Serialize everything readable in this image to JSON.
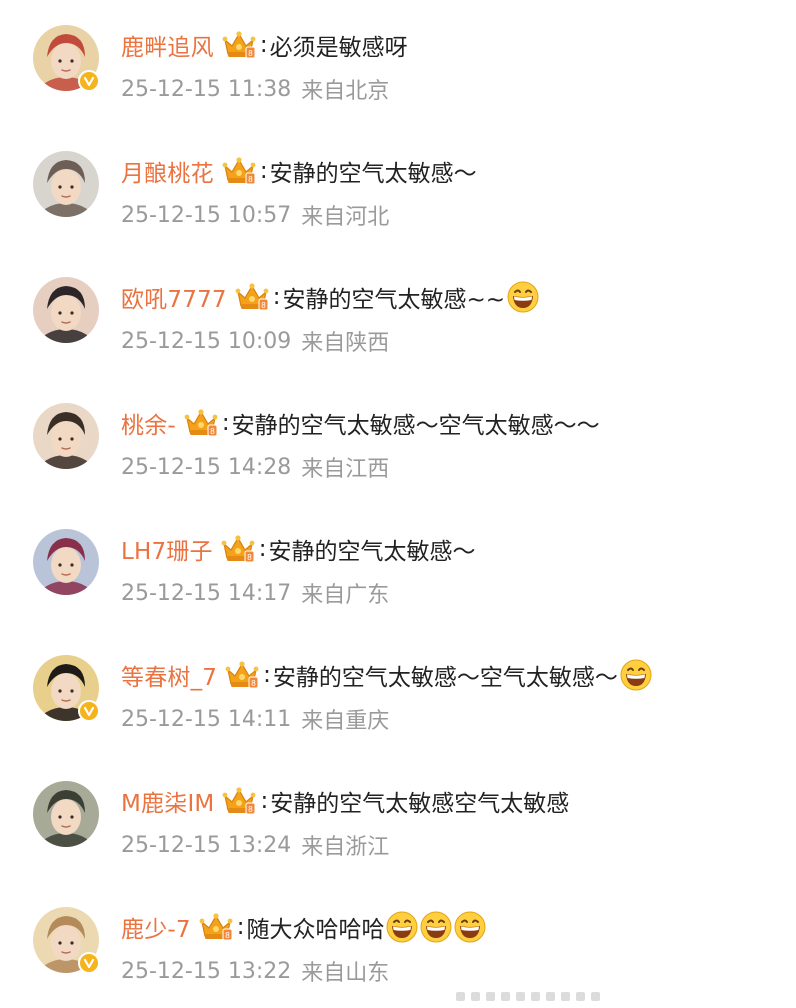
{
  "comments": [
    {
      "username": "鹿畔追风",
      "text": "必须是敏感呀",
      "time": "25-12-15 11:38",
      "location": "来自北京",
      "verified": true,
      "emoji_count": 0,
      "avatar_colors": [
        "#e9d2a6",
        "#c24a3c"
      ]
    },
    {
      "username": "月酿桃花",
      "text": "安静的空气太敏感～",
      "time": "25-12-15 10:57",
      "location": "来自河北",
      "verified": false,
      "emoji_count": 0,
      "avatar_colors": [
        "#d8d5cf",
        "#6d5f55"
      ]
    },
    {
      "username": "欧吼7777",
      "text": "安静的空气太敏感~~",
      "time": "25-12-15 10:09",
      "location": "来自陕西",
      "verified": false,
      "emoji_count": 1,
      "avatar_colors": [
        "#e6cfc0",
        "#2c2628"
      ]
    },
    {
      "username": "桃余-",
      "text": "安静的空气太敏感～空气太敏感～～",
      "time": "25-12-15 14:28",
      "location": "来自江西",
      "verified": false,
      "emoji_count": 0,
      "avatar_colors": [
        "#ead8c6",
        "#3a2e27"
      ]
    },
    {
      "username": "LH7珊子",
      "text": "安静的空气太敏感～",
      "time": "25-12-15 14:17",
      "location": "来自广东",
      "verified": false,
      "emoji_count": 0,
      "avatar_colors": [
        "#b9c4d9",
        "#8a2f4a"
      ]
    },
    {
      "username": "等春树_7",
      "text": "安静的空气太敏感～空气太敏感～",
      "time": "25-12-15 14:11",
      "location": "来自重庆",
      "verified": true,
      "emoji_count": 1,
      "avatar_colors": [
        "#e8cf8c",
        "#1e1a1a"
      ]
    },
    {
      "username": "M鹿柒IM",
      "text": "安静的空气太敏感空气太敏感",
      "time": "25-12-15 13:24",
      "location": "来自浙江",
      "verified": false,
      "emoji_count": 0,
      "avatar_colors": [
        "#a8aa98",
        "#3c3f34"
      ]
    },
    {
      "username": "鹿少-7",
      "text": "随大众哈哈哈",
      "time": "25-12-15 13:22",
      "location": "来自山东",
      "verified": true,
      "emoji_count": 3,
      "avatar_colors": [
        "#ecd9b2",
        "#b48a5a"
      ]
    }
  ],
  "icons": {
    "crown": "vip-crown-icon",
    "verified": "verified-badge-icon",
    "emoji": "grin-emoji-icon"
  },
  "colors": {
    "username": "#eb7340",
    "meta": "#9a9a9a",
    "text": "#222222",
    "badge": "#f5b31c"
  }
}
